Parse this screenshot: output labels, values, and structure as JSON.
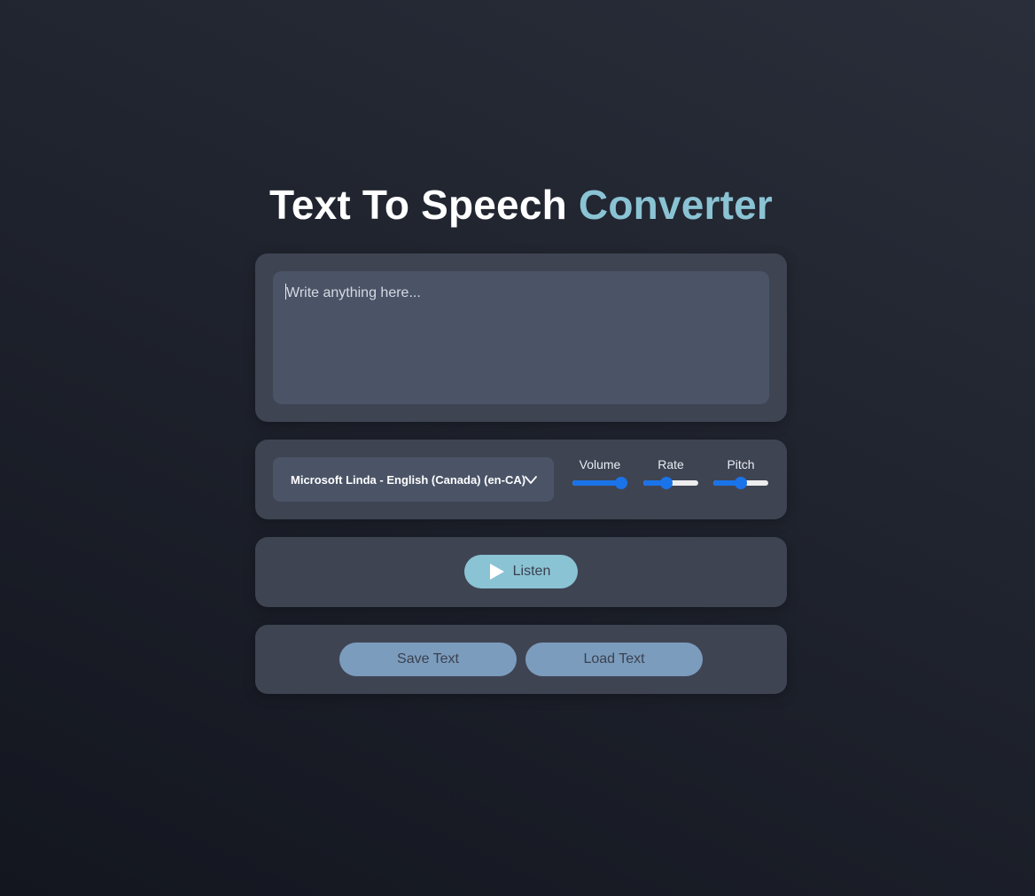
{
  "title": {
    "main": "Text To Speech ",
    "accent": "Converter"
  },
  "text_input": {
    "value": "",
    "placeholder": "Write anything here..."
  },
  "voice_select": {
    "selected": "Microsoft Linda - English (Canada) (en-CA)",
    "icon": "chevron-down-icon"
  },
  "sliders": [
    {
      "label": "Volume",
      "value": 1.0,
      "min": 0,
      "max": 1
    },
    {
      "label": "Rate",
      "value": 0.4,
      "min": 0,
      "max": 1
    },
    {
      "label": "Pitch",
      "value": 0.5,
      "min": 0,
      "max": 1
    }
  ],
  "listen_button": {
    "label": "Listen",
    "icon": "play-icon"
  },
  "save_button": {
    "label": "Save Text"
  },
  "load_button": {
    "label": "Load Text"
  },
  "colors": {
    "accent": "#8ac3d4",
    "panel": "#3f4453",
    "input": "#4b5467",
    "slider": "#1a73e8",
    "pill": "#7b9cbd"
  }
}
